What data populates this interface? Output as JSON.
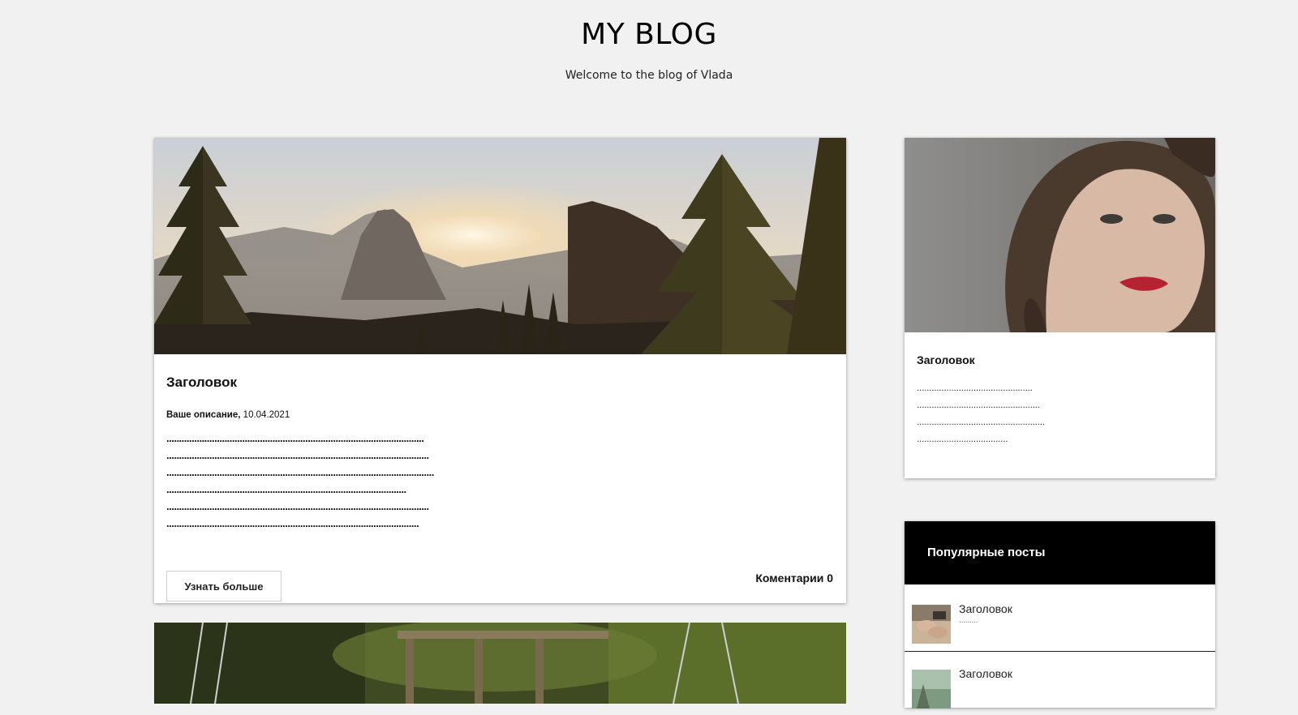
{
  "header": {
    "title": "MY BLOG",
    "subtitle": "Welcome to the blog of Vlada"
  },
  "main_post": {
    "image_icon": "mountain-landscape-image",
    "title": "Заголовок",
    "meta_description": "Ваше описание,",
    "meta_date": "10.04.2021",
    "body_lines": [
      "......................................................................................................",
      "........................................................................................................",
      "..........................................................................................................",
      "...............................................................................................",
      "........................................................................................................",
      "...................................................................................................."
    ],
    "read_more_label": "Узнать больше",
    "comments_label": "Коментарии",
    "comments_count": "0"
  },
  "second_post": {
    "image_icon": "swing-forest-image"
  },
  "about": {
    "image_icon": "portrait-image",
    "title": "Заголовок",
    "body_lines": [
      "...............................................",
      "..................................................",
      "....................................................",
      "....................................."
    ]
  },
  "popular": {
    "header": "Популярные посты",
    "items": [
      {
        "title": "Заголовок",
        "subtitle": ".........",
        "thumb_icon": "hands-thumbnail"
      },
      {
        "title": "Заголовок",
        "subtitle": "",
        "thumb_icon": "landscape-thumbnail"
      }
    ]
  },
  "colors": {
    "page_background": "#f1f1f1",
    "card_background": "#ffffff",
    "popular_header_background": "#000000"
  }
}
